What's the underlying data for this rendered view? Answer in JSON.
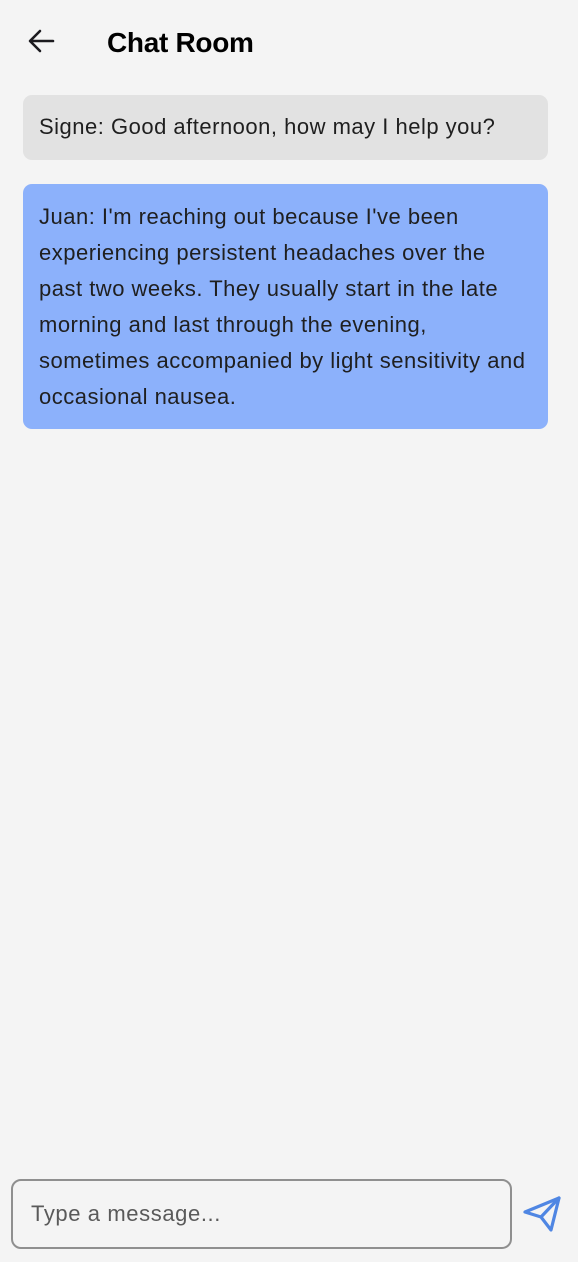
{
  "header": {
    "back_icon": "arrow-left-icon",
    "title": "Chat Room"
  },
  "messages": [
    {
      "sender": "Signe",
      "text": "Signe: Good afternoon, how may I help you?",
      "side": "other",
      "color": "#e2e2e2"
    },
    {
      "sender": "Juan",
      "text": "Juan: I'm reaching out because I've been experiencing persistent headaches over the past two weeks. They usually start in the late morning and last through the evening, sometimes accompanied by light sensitivity and occasional nausea.",
      "side": "me",
      "color": "#8cb1fb"
    }
  ],
  "composer": {
    "placeholder": "Type a message...",
    "value": "",
    "send_icon": "send-icon",
    "accent": "#4f86e3"
  }
}
